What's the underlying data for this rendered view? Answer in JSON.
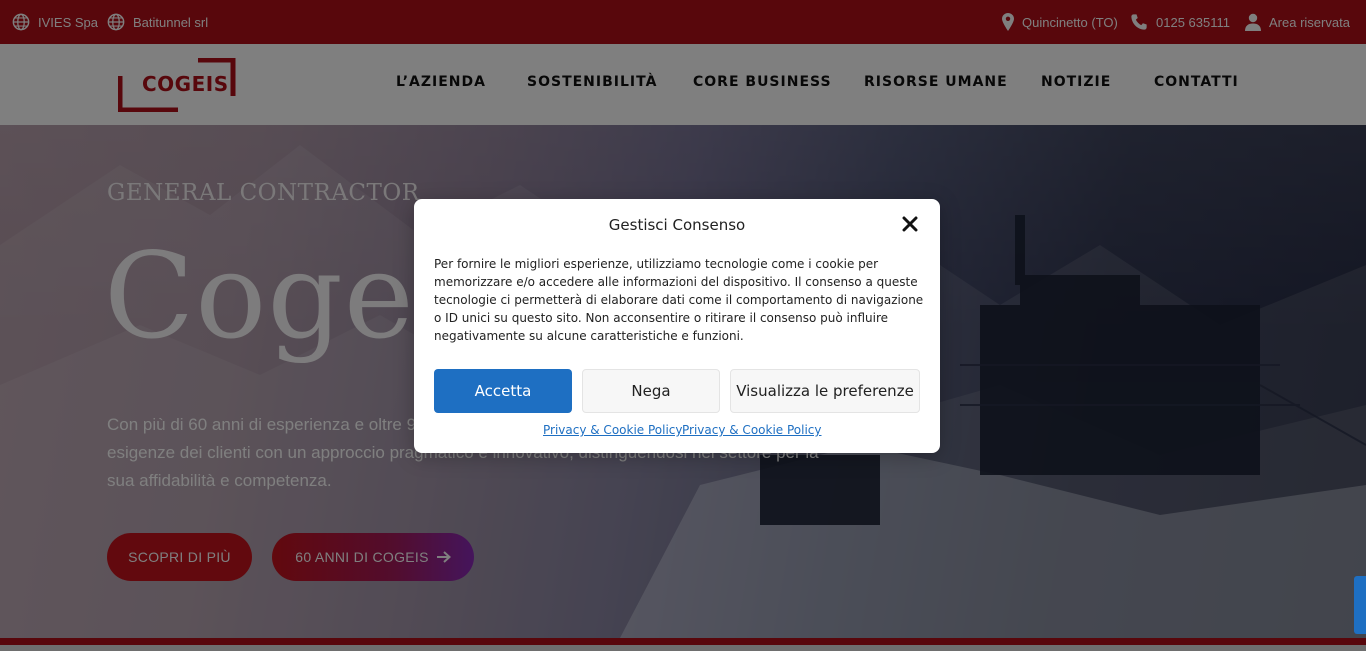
{
  "topbar": {
    "left_links": [
      {
        "label": "IVIES Spa",
        "icon": "globe-icon"
      },
      {
        "label": "Batitunnel srl",
        "icon": "globe-icon"
      }
    ],
    "location": {
      "label": "Quincinetto (TO)",
      "icon": "map-pin-icon"
    },
    "phone": {
      "label": "0125 635111",
      "icon": "phone-icon"
    },
    "account": {
      "label": "Area riservata",
      "icon": "user-icon"
    }
  },
  "header": {
    "logo_text": "COGEIS",
    "nav": [
      "L’AZIENDA",
      "SOSTENIBILITÀ",
      "CORE BUSINESS",
      "RISORSE UMANE",
      "NOTIZIE",
      "CONTATTI"
    ]
  },
  "hero": {
    "eyebrow": "GENERAL CONTRACTOR",
    "title": "Cogeis",
    "description": "Con più di 60 anni di esperienza e oltre 90 opere realizzate, Cogeis risponde rapidamente alle esigenze dei clienti con un approccio pragmatico e innovativo, distinguendosi nel settore per la sua affidabilità e competenza.",
    "button_primary": "SCOPRI DI PIÙ",
    "button_secondary": "60 ANNI DI COGEIS",
    "button_secondary_icon": "arrow-right-icon"
  },
  "consent": {
    "title": "Gestisci Consenso",
    "close_icon": "close-icon",
    "text": "Per fornire le migliori esperienze, utilizziamo tecnologie come i cookie per memorizzare e/o accedere alle informazioni del dispositivo. Il consenso a queste tecnologie ci permetterà di elaborare dati come il comportamento di navigazione o ID unici su questo sito. Non acconsentire o ritirare il consenso può influire negativamente su alcune caratteristiche e funzioni.",
    "accept_label": "Accetta",
    "deny_label": "Nega",
    "preferences_label": "Visualizza le preferenze",
    "links": [
      "Privacy & Cookie Policy",
      "Privacy & Cookie Policy"
    ]
  },
  "colors": {
    "brand_red": "#b10f18",
    "accent_blue": "#1e6fc2"
  }
}
